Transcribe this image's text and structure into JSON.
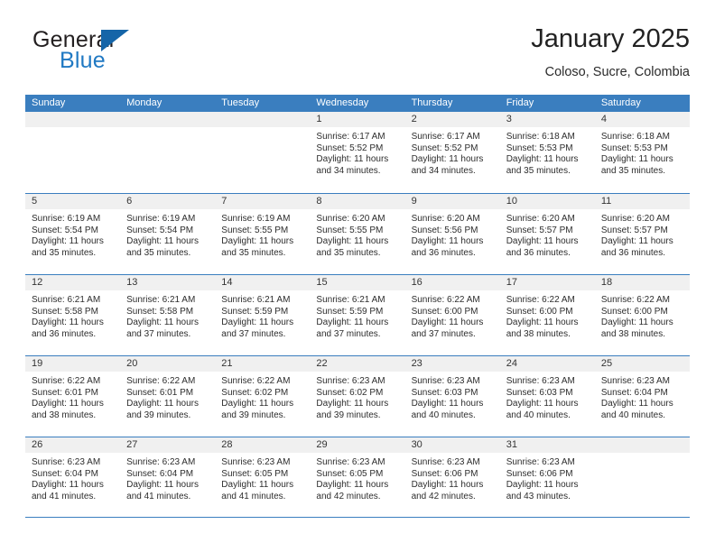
{
  "brand": {
    "word_one": "General",
    "word_two": "Blue",
    "triangle_color": "#1565a8",
    "blue_text_color": "#2079c3"
  },
  "header": {
    "title": "January 2025",
    "subtitle": "Coloso, Sucre, Colombia"
  },
  "theme": {
    "header_blue": "#3a7ebf",
    "day_band_gray": "#f0f0f0",
    "text_dark": "#2d2d2d"
  },
  "weekday_headers": [
    "Sunday",
    "Monday",
    "Tuesday",
    "Wednesday",
    "Thursday",
    "Friday",
    "Saturday"
  ],
  "weeks": [
    [
      {
        "day": "",
        "sunrise": "",
        "sunset": "",
        "daylight_a": "",
        "daylight_b": ""
      },
      {
        "day": "",
        "sunrise": "",
        "sunset": "",
        "daylight_a": "",
        "daylight_b": ""
      },
      {
        "day": "",
        "sunrise": "",
        "sunset": "",
        "daylight_a": "",
        "daylight_b": ""
      },
      {
        "day": "1",
        "sunrise": "Sunrise: 6:17 AM",
        "sunset": "Sunset: 5:52 PM",
        "daylight_a": "Daylight: 11 hours",
        "daylight_b": "and 34 minutes."
      },
      {
        "day": "2",
        "sunrise": "Sunrise: 6:17 AM",
        "sunset": "Sunset: 5:52 PM",
        "daylight_a": "Daylight: 11 hours",
        "daylight_b": "and 34 minutes."
      },
      {
        "day": "3",
        "sunrise": "Sunrise: 6:18 AM",
        "sunset": "Sunset: 5:53 PM",
        "daylight_a": "Daylight: 11 hours",
        "daylight_b": "and 35 minutes."
      },
      {
        "day": "4",
        "sunrise": "Sunrise: 6:18 AM",
        "sunset": "Sunset: 5:53 PM",
        "daylight_a": "Daylight: 11 hours",
        "daylight_b": "and 35 minutes."
      }
    ],
    [
      {
        "day": "5",
        "sunrise": "Sunrise: 6:19 AM",
        "sunset": "Sunset: 5:54 PM",
        "daylight_a": "Daylight: 11 hours",
        "daylight_b": "and 35 minutes."
      },
      {
        "day": "6",
        "sunrise": "Sunrise: 6:19 AM",
        "sunset": "Sunset: 5:54 PM",
        "daylight_a": "Daylight: 11 hours",
        "daylight_b": "and 35 minutes."
      },
      {
        "day": "7",
        "sunrise": "Sunrise: 6:19 AM",
        "sunset": "Sunset: 5:55 PM",
        "daylight_a": "Daylight: 11 hours",
        "daylight_b": "and 35 minutes."
      },
      {
        "day": "8",
        "sunrise": "Sunrise: 6:20 AM",
        "sunset": "Sunset: 5:55 PM",
        "daylight_a": "Daylight: 11 hours",
        "daylight_b": "and 35 minutes."
      },
      {
        "day": "9",
        "sunrise": "Sunrise: 6:20 AM",
        "sunset": "Sunset: 5:56 PM",
        "daylight_a": "Daylight: 11 hours",
        "daylight_b": "and 36 minutes."
      },
      {
        "day": "10",
        "sunrise": "Sunrise: 6:20 AM",
        "sunset": "Sunset: 5:57 PM",
        "daylight_a": "Daylight: 11 hours",
        "daylight_b": "and 36 minutes."
      },
      {
        "day": "11",
        "sunrise": "Sunrise: 6:20 AM",
        "sunset": "Sunset: 5:57 PM",
        "daylight_a": "Daylight: 11 hours",
        "daylight_b": "and 36 minutes."
      }
    ],
    [
      {
        "day": "12",
        "sunrise": "Sunrise: 6:21 AM",
        "sunset": "Sunset: 5:58 PM",
        "daylight_a": "Daylight: 11 hours",
        "daylight_b": "and 36 minutes."
      },
      {
        "day": "13",
        "sunrise": "Sunrise: 6:21 AM",
        "sunset": "Sunset: 5:58 PM",
        "daylight_a": "Daylight: 11 hours",
        "daylight_b": "and 37 minutes."
      },
      {
        "day": "14",
        "sunrise": "Sunrise: 6:21 AM",
        "sunset": "Sunset: 5:59 PM",
        "daylight_a": "Daylight: 11 hours",
        "daylight_b": "and 37 minutes."
      },
      {
        "day": "15",
        "sunrise": "Sunrise: 6:21 AM",
        "sunset": "Sunset: 5:59 PM",
        "daylight_a": "Daylight: 11 hours",
        "daylight_b": "and 37 minutes."
      },
      {
        "day": "16",
        "sunrise": "Sunrise: 6:22 AM",
        "sunset": "Sunset: 6:00 PM",
        "daylight_a": "Daylight: 11 hours",
        "daylight_b": "and 37 minutes."
      },
      {
        "day": "17",
        "sunrise": "Sunrise: 6:22 AM",
        "sunset": "Sunset: 6:00 PM",
        "daylight_a": "Daylight: 11 hours",
        "daylight_b": "and 38 minutes."
      },
      {
        "day": "18",
        "sunrise": "Sunrise: 6:22 AM",
        "sunset": "Sunset: 6:00 PM",
        "daylight_a": "Daylight: 11 hours",
        "daylight_b": "and 38 minutes."
      }
    ],
    [
      {
        "day": "19",
        "sunrise": "Sunrise: 6:22 AM",
        "sunset": "Sunset: 6:01 PM",
        "daylight_a": "Daylight: 11 hours",
        "daylight_b": "and 38 minutes."
      },
      {
        "day": "20",
        "sunrise": "Sunrise: 6:22 AM",
        "sunset": "Sunset: 6:01 PM",
        "daylight_a": "Daylight: 11 hours",
        "daylight_b": "and 39 minutes."
      },
      {
        "day": "21",
        "sunrise": "Sunrise: 6:22 AM",
        "sunset": "Sunset: 6:02 PM",
        "daylight_a": "Daylight: 11 hours",
        "daylight_b": "and 39 minutes."
      },
      {
        "day": "22",
        "sunrise": "Sunrise: 6:23 AM",
        "sunset": "Sunset: 6:02 PM",
        "daylight_a": "Daylight: 11 hours",
        "daylight_b": "and 39 minutes."
      },
      {
        "day": "23",
        "sunrise": "Sunrise: 6:23 AM",
        "sunset": "Sunset: 6:03 PM",
        "daylight_a": "Daylight: 11 hours",
        "daylight_b": "and 40 minutes."
      },
      {
        "day": "24",
        "sunrise": "Sunrise: 6:23 AM",
        "sunset": "Sunset: 6:03 PM",
        "daylight_a": "Daylight: 11 hours",
        "daylight_b": "and 40 minutes."
      },
      {
        "day": "25",
        "sunrise": "Sunrise: 6:23 AM",
        "sunset": "Sunset: 6:04 PM",
        "daylight_a": "Daylight: 11 hours",
        "daylight_b": "and 40 minutes."
      }
    ],
    [
      {
        "day": "26",
        "sunrise": "Sunrise: 6:23 AM",
        "sunset": "Sunset: 6:04 PM",
        "daylight_a": "Daylight: 11 hours",
        "daylight_b": "and 41 minutes."
      },
      {
        "day": "27",
        "sunrise": "Sunrise: 6:23 AM",
        "sunset": "Sunset: 6:04 PM",
        "daylight_a": "Daylight: 11 hours",
        "daylight_b": "and 41 minutes."
      },
      {
        "day": "28",
        "sunrise": "Sunrise: 6:23 AM",
        "sunset": "Sunset: 6:05 PM",
        "daylight_a": "Daylight: 11 hours",
        "daylight_b": "and 41 minutes."
      },
      {
        "day": "29",
        "sunrise": "Sunrise: 6:23 AM",
        "sunset": "Sunset: 6:05 PM",
        "daylight_a": "Daylight: 11 hours",
        "daylight_b": "and 42 minutes."
      },
      {
        "day": "30",
        "sunrise": "Sunrise: 6:23 AM",
        "sunset": "Sunset: 6:06 PM",
        "daylight_a": "Daylight: 11 hours",
        "daylight_b": "and 42 minutes."
      },
      {
        "day": "31",
        "sunrise": "Sunrise: 6:23 AM",
        "sunset": "Sunset: 6:06 PM",
        "daylight_a": "Daylight: 11 hours",
        "daylight_b": "and 43 minutes."
      },
      {
        "day": "",
        "sunrise": "",
        "sunset": "",
        "daylight_a": "",
        "daylight_b": ""
      }
    ]
  ]
}
